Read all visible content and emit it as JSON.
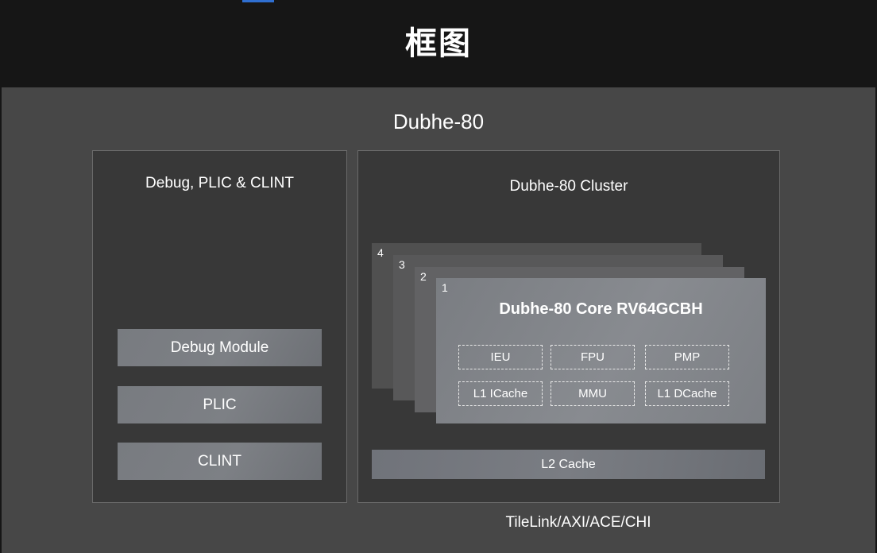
{
  "header": {
    "title": "框图"
  },
  "diagram": {
    "title": "Dubhe-80",
    "left_panel": {
      "title": "Debug, PLIC & CLINT",
      "modules": [
        "Debug Module",
        "PLIC",
        "CLINT"
      ]
    },
    "cluster": {
      "title": "Dubhe-80 Cluster",
      "layer_numbers": [
        "4",
        "3",
        "2",
        "1"
      ],
      "core": {
        "title": "Dubhe-80 Core RV64GCBH",
        "units": [
          "IEU",
          "FPU",
          "PMP",
          "L1 ICache",
          "MMU",
          "L1 DCache"
        ]
      },
      "l2": "L2 Cache"
    },
    "bus": "TileLink/AXI/ACE/CHI"
  }
}
